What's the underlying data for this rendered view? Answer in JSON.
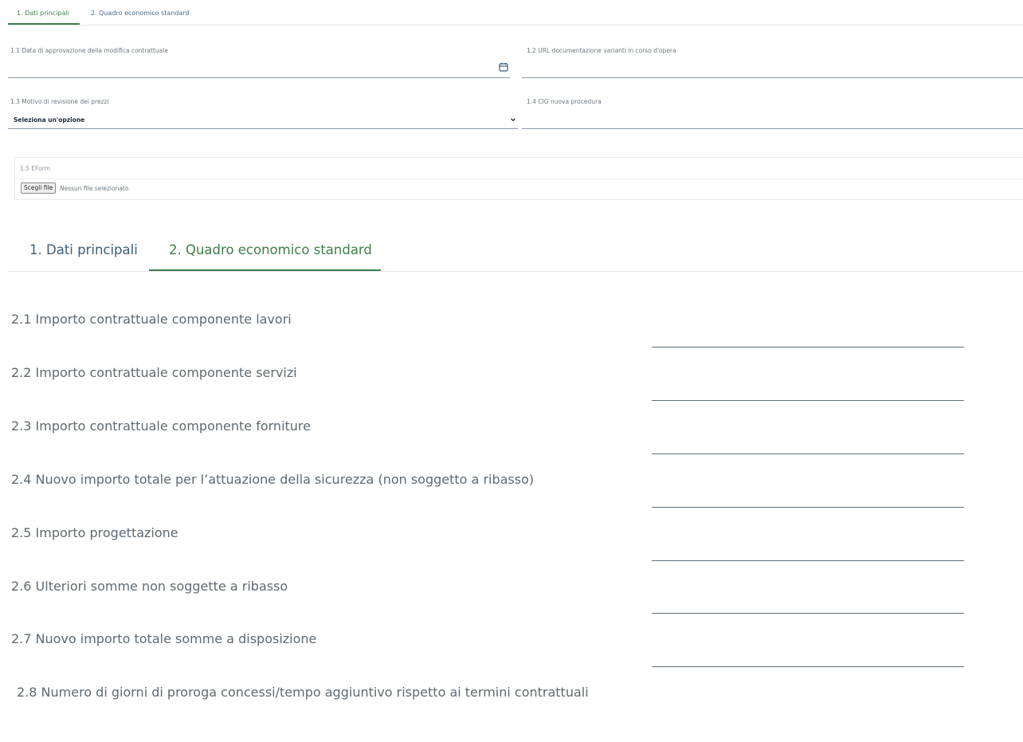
{
  "top_tabs": [
    {
      "label": "1. Dati principali",
      "active": true
    },
    {
      "label": "2. Quadro economico standard",
      "active": false
    }
  ],
  "section1": {
    "field_1_1": {
      "label": "1.1 Data di approvazione della modifica contrattuale",
      "value": "",
      "icon": "calendar-icon"
    },
    "field_1_2": {
      "label": "1.2 URL documentazione varianti in corso d'opera",
      "value": ""
    },
    "field_1_3": {
      "label": "1.3 Motivo di revisione dei prezzi",
      "selected": "Seleziona un'opzione",
      "icon": "chevron-down-icon"
    },
    "field_1_4": {
      "label": "1.4 CIG nuova procedura",
      "value": ""
    },
    "eform": {
      "label": "1.5 EForm",
      "button_label": "Scegli file",
      "status": "Nessun file selezionato"
    }
  },
  "big_tabs": [
    {
      "label": "1. Dati principali",
      "active": false
    },
    {
      "label": "2. Quadro economico standard",
      "active": true
    }
  ],
  "section2": {
    "rows": [
      {
        "label": "2.1 Importo contrattuale componente lavori",
        "value": ""
      },
      {
        "label": "2.2 Importo contrattuale componente servizi",
        "value": ""
      },
      {
        "label": "2.3 Importo contrattuale componente forniture",
        "value": ""
      },
      {
        "label": "2.4 Nuovo importo totale per l’attuazione della sicurezza (non soggetto a ribasso)",
        "value": ""
      },
      {
        "label": "2.5 Importo progettazione",
        "value": ""
      },
      {
        "label": "2.6 Ulteriori somme non soggette a ribasso",
        "value": ""
      },
      {
        "label": "2.7 Nuovo importo totale somme a disposizione",
        "value": ""
      },
      {
        "label": "2.8 Numero di giorni di proroga concessi/tempo aggiuntivo rispetto ai termini contrattuali",
        "value": ""
      }
    ]
  },
  "colors": {
    "accent_green": "#3f7e4d",
    "tab_blue": "#3d5e7a",
    "line_gray": "#5f6e7c"
  }
}
